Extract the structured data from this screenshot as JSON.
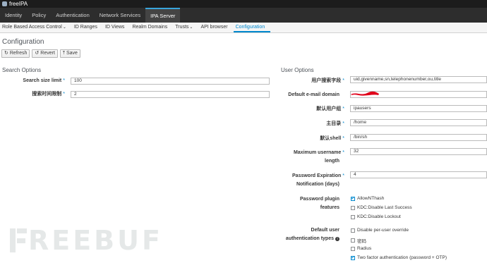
{
  "app": {
    "brand": "freeIPA"
  },
  "mainnav": [
    {
      "label": "Identity",
      "active": false
    },
    {
      "label": "Policy",
      "active": false
    },
    {
      "label": "Authentication",
      "active": false
    },
    {
      "label": "Network Services",
      "active": false
    },
    {
      "label": "IPA Server",
      "active": true
    }
  ],
  "subnav": [
    {
      "label": "Role Based Access Control",
      "caret": true
    },
    {
      "label": "ID Ranges",
      "caret": false
    },
    {
      "label": "ID Views",
      "caret": false
    },
    {
      "label": "Realm Domains",
      "caret": false
    },
    {
      "label": "Trusts",
      "caret": true
    },
    {
      "label": "API browser",
      "caret": false
    },
    {
      "label": "Configuration",
      "caret": false,
      "active": true
    }
  ],
  "page": {
    "title": "Configuration"
  },
  "toolbar": {
    "refresh": "Refresh",
    "revert": "Revert",
    "save": "Save"
  },
  "search": {
    "heading": "Search Options",
    "size_limit_label": "Search size limit",
    "size_limit_value": "100",
    "time_limit_label": "搜索时间限制",
    "time_limit_value": "2"
  },
  "user": {
    "heading": "User Options",
    "search_fields_label": "用户搜索字段",
    "search_fields_value": "uid,givenname,sn,telephonenumber,ou,title",
    "email_domain_label": "Default e-mail domain",
    "email_domain_value": "",
    "default_group_label": "默认用户组",
    "default_group_value": "ipausers",
    "home_label": "主目录",
    "home_value": "/home",
    "shell_label": "默认shell",
    "shell_value": "/bin/sh",
    "max_username_label_1": "Maximum username",
    "max_username_label_2": "length",
    "max_username_value": "32",
    "pw_expiration_label_1": "Password Expiration",
    "pw_expiration_label_2": "Notification (days)",
    "pw_expiration_value": "4",
    "pw_plugin_label_1": "Password plugin",
    "pw_plugin_label_2": "features",
    "pw_plugin_options": [
      {
        "label": "AllowNThash",
        "checked": true
      },
      {
        "label": "KDC:Disable Last Success",
        "checked": false
      },
      {
        "label": "KDC:Disable Lockout",
        "checked": false
      }
    ],
    "auth_types_label_1": "Default user",
    "auth_types_label_2": "authentication types",
    "auth_types_options": [
      {
        "label": "Disable per-user override",
        "checked": false
      },
      {
        "label": "密码",
        "checked": false
      },
      {
        "label": "Radius",
        "checked": false
      },
      {
        "label": "Two factor authentication (password + OTP)",
        "checked": true
      }
    ]
  },
  "watermark": {
    "text": "REEBUF"
  },
  "colors": {
    "accent": "#0088ce",
    "nav_bg": "#2d2d2d",
    "redact": "#e0001a"
  }
}
